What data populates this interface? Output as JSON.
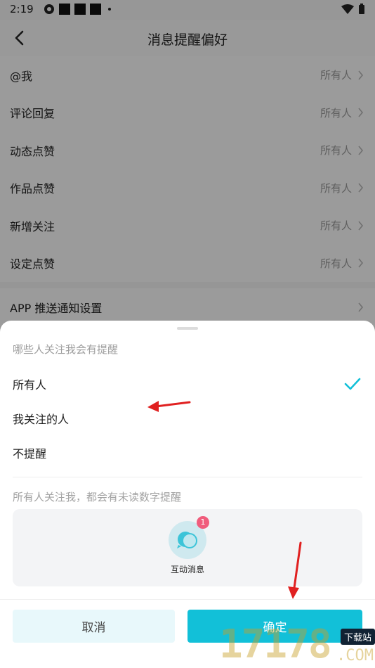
{
  "status_bar": {
    "time": "2:19"
  },
  "header": {
    "title": "消息提醒偏好"
  },
  "settings": [
    {
      "label": "@我",
      "value": "所有人"
    },
    {
      "label": "评论回复",
      "value": "所有人"
    },
    {
      "label": "动态点赞",
      "value": "所有人"
    },
    {
      "label": "作品点赞",
      "value": "所有人"
    },
    {
      "label": "新增关注",
      "value": "所有人"
    },
    {
      "label": "设定点赞",
      "value": "所有人"
    }
  ],
  "push_settings": {
    "label": "APP 推送通知设置"
  },
  "sheet": {
    "title": "哪些人关注我会有提醒",
    "options": [
      {
        "label": "所有人",
        "selected": true
      },
      {
        "label": "我关注的人",
        "selected": false
      },
      {
        "label": "不提醒",
        "selected": false
      }
    ],
    "note": "所有人关注我，都会有未读数字提醒",
    "preview": {
      "badge": "1",
      "label": "互动消息"
    },
    "cancel_label": "取消",
    "confirm_label": "确定"
  },
  "watermark": {
    "text": "17178",
    "tag": "下载站",
    "suffix": ".COM"
  },
  "colors": {
    "accent": "#12c0d8",
    "badge": "#f05c7c",
    "annotation": "#e02020"
  }
}
